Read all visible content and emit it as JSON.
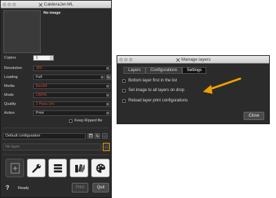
{
  "main_window": {
    "title": "CalderaJet-ML",
    "preview_text": "No image",
    "settings": [
      {
        "label": "Copies",
        "value": "1"
      },
      {
        "label": "Resolution",
        "value": "360"
      },
      {
        "label": "Loading",
        "value": "Full"
      },
      {
        "label": "Media",
        "value": "Backlit"
      },
      {
        "label": "Mode",
        "value": "CMYK"
      },
      {
        "label": "Quality",
        "value": "2 Pass Uni"
      },
      {
        "label": "Action",
        "value": "Print"
      }
    ],
    "keep_ripped_label": "Keep Ripped file",
    "configuration_value": "Default configuration",
    "layer_placeholder": "No layer",
    "layer_button_label": "...",
    "status_text": "Ready",
    "help_label": "?",
    "print_label": "Print",
    "quit_label": "Quit",
    "colors": {
      "accent": "#f0a000",
      "red_value": "#e0453a",
      "window_bg": "#2b2b2b"
    }
  },
  "layers_window": {
    "title": "Manage layers",
    "tabs": [
      {
        "label": "Layers",
        "active": false
      },
      {
        "label": "Configurations",
        "active": false
      },
      {
        "label": "Settings",
        "active": true
      }
    ],
    "options": [
      {
        "label": "Bottom layer first in the list",
        "checked": false
      },
      {
        "label": "Set image to all layers on drop",
        "checked": false
      },
      {
        "label": "Reload layer print configurations",
        "checked": false
      }
    ],
    "close_label": "Close"
  }
}
